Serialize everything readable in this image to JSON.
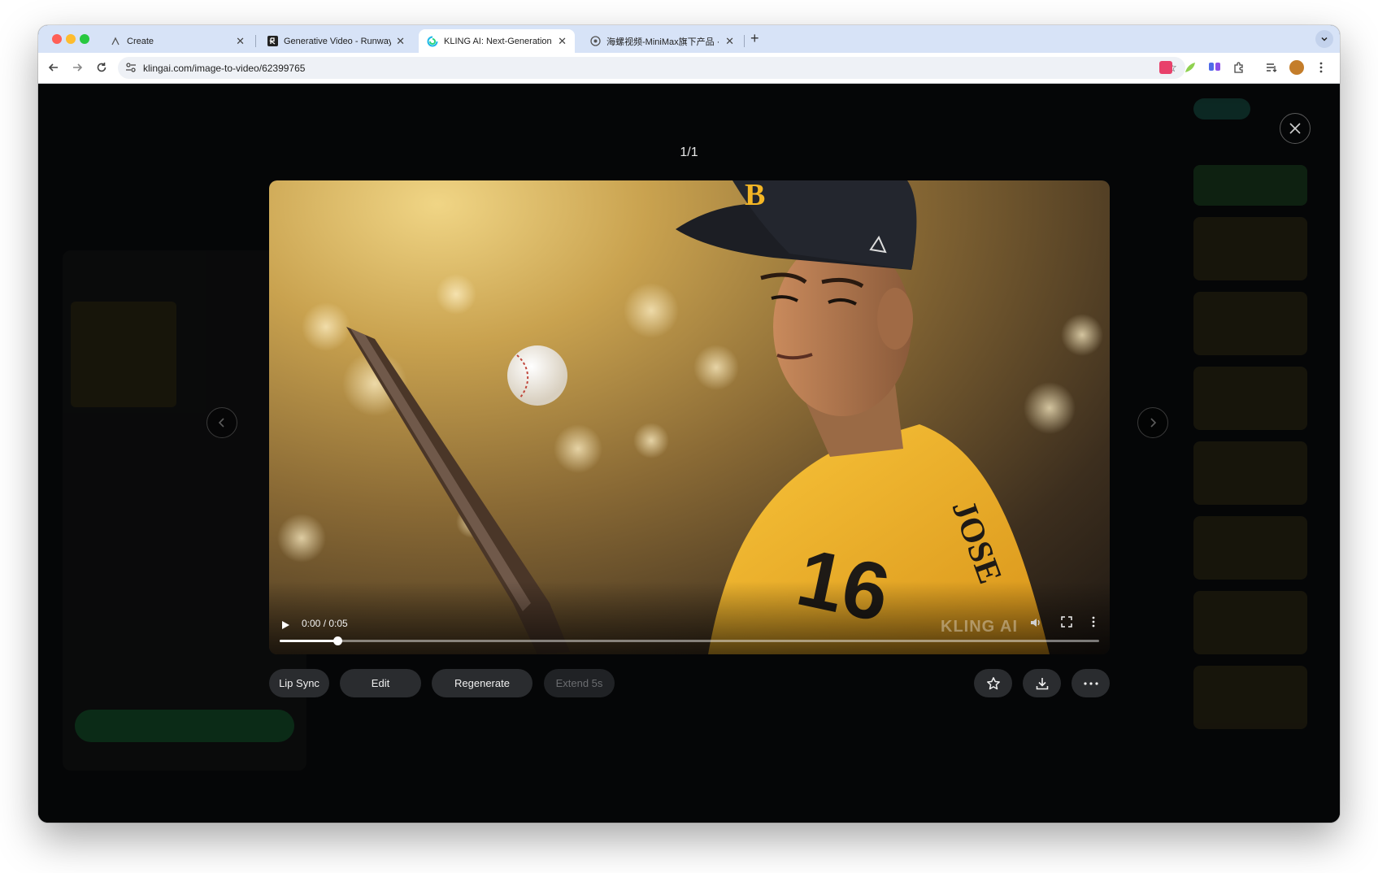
{
  "browser": {
    "tabs": [
      {
        "title": "Create",
        "icon": "runway-create-icon"
      },
      {
        "title": "Generative Video - Runway",
        "icon": "runway-icon"
      },
      {
        "title": "KLING AI: Next-Generation AI",
        "icon": "kling-icon"
      },
      {
        "title": "海螺视频-MiniMax旗下产品 · 与",
        "icon": "hailuo-icon"
      }
    ],
    "url": "klingai.com/image-to-video/62399765"
  },
  "viewer": {
    "counter": "1/1",
    "player": {
      "time": "0:00 / 0:05",
      "progress_fraction": 0.07,
      "watermark": "KLING AI"
    },
    "actions": {
      "lip_sync": "Lip Sync",
      "edit": "Edit",
      "regenerate": "Regenerate",
      "extend": "Extend 5s"
    }
  },
  "colors": {
    "page_bg": "#050607",
    "button_bg": "#2a2c2f",
    "tab_strip": "#d7e3f7",
    "jersey": "#f4b625"
  }
}
